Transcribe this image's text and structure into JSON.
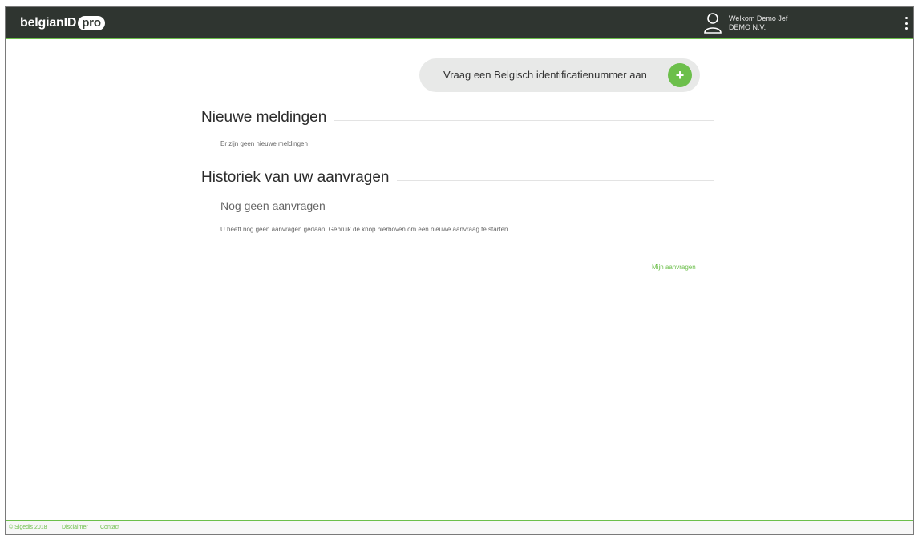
{
  "header": {
    "logo_text": "belgianID",
    "logo_badge": "pro",
    "welcome": "Welkom Demo Jef",
    "company": "DEMO N.V."
  },
  "cta": {
    "label": "Vraag een Belgisch identificatienummer aan",
    "plus": "+"
  },
  "notifications": {
    "title": "Nieuwe meldingen",
    "empty_text": "Er zijn geen nieuwe meldingen"
  },
  "history": {
    "title": "Historiek van uw aanvragen",
    "subheading": "Nog geen aanvragen",
    "description": "U heeft nog geen aanvragen gedaan. Gebruik de knop hierboven om een nieuwe aanvraag te starten.",
    "link": "Mijn aanvragen"
  },
  "footer": {
    "copyright": "© Sigedis 2018",
    "disclaimer": "Disclaimer",
    "contact": "Contact"
  },
  "colors": {
    "header_bg": "#2f3530",
    "accent": "#6cbf4b"
  },
  "icons": {
    "user": "user-icon",
    "menu": "kebab-menu-icon",
    "add": "plus-icon"
  }
}
